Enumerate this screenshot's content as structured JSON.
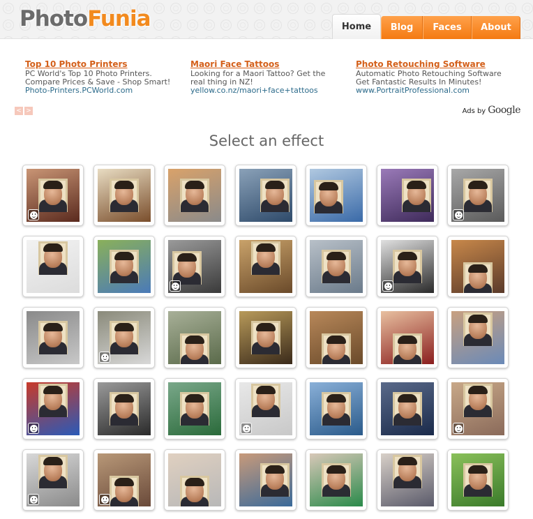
{
  "site": {
    "logo_part1": "Photo",
    "logo_part2": "Funia"
  },
  "nav": {
    "tabs": [
      "Home",
      "Blog",
      "Faces",
      "About"
    ],
    "active": "Home"
  },
  "ads": [
    {
      "title": "Top 10 Photo Printers",
      "line1": "PC World's Top 10 Photo Printers.",
      "line2": "Compare Prices & Save - Shop Smart!",
      "url": "Photo-Printers.PCWorld.com"
    },
    {
      "title": "Maori Face Tattoos",
      "line1": "Looking for a Maori Tattoo? Get the",
      "line2": "real thing in NZ!",
      "url": "yellow.co.nz/maori+face+tattoos"
    },
    {
      "title": "Photo Retouching Software",
      "line1": "Automatic Photo Retouching Software",
      "line2": "Get Fantastic Results In Minutes!",
      "url": "www.PortraitProfessional.com"
    }
  ],
  "ads_nav": {
    "prev": "<",
    "next": ">"
  },
  "ads_by": {
    "label": "Ads by",
    "brand": "Google"
  },
  "heading": "Select an effect",
  "colors": {
    "accent": "#f47a12",
    "ad_title": "#d4601a",
    "ad_url": "#2b6a8a"
  },
  "effects_icon": "smiley-face-icon",
  "effects": [
    [
      {
        "name": "carnival-dancer",
        "bg": "#5a2a1e",
        "bg2": "#c99575",
        "face": "center",
        "smiley": true
      },
      {
        "name": "old-book-page",
        "bg": "#7a4e2c",
        "bg2": "#e8dcc2",
        "face": "center",
        "smiley": false
      },
      {
        "name": "mall-poster",
        "bg": "#8a8a8a",
        "bg2": "#d9a26a",
        "face": "center",
        "smiley": false
      },
      {
        "name": "city-billboard",
        "bg": "#2e4a6a",
        "bg2": "#8aa1b8",
        "face": "right",
        "smiley": false
      },
      {
        "name": "skyscraper-billboard",
        "bg": "#3a6aa8",
        "bg2": "#b0c8e0",
        "face": "left",
        "smiley": false
      },
      {
        "name": "purple-sky-screen",
        "bg": "#3e2a5a",
        "bg2": "#9a7ab8",
        "face": "right",
        "smiley": false
      },
      {
        "name": "pirate-captain",
        "bg": "#5a5a5a",
        "bg2": "#a8a8a8",
        "face": "center",
        "smiley": true
      }
    ],
    [
      {
        "name": "pop-art-gallery",
        "bg": "#dcdcdc",
        "bg2": "#f2f2f2",
        "face": "top",
        "smiley": false
      },
      {
        "name": "park-poster",
        "bg": "#4a7ab8",
        "bg2": "#8ab05a",
        "face": "center",
        "smiley": false
      },
      {
        "name": "hooded-portrait",
        "bg": "#3a3a3a",
        "bg2": "#9a9a9a",
        "face": "left",
        "smiley": true
      },
      {
        "name": "palace-facade",
        "bg": "#6a4a2a",
        "bg2": "#c9a26a",
        "face": "top",
        "smiley": false
      },
      {
        "name": "city-mosaic",
        "bg": "#6a7a8a",
        "bg2": "#b8c0c8",
        "face": "center",
        "smiley": false
      },
      {
        "name": "bride-portrait",
        "bg": "#2a2a2a",
        "bg2": "#e0e0e0",
        "face": "center",
        "smiley": true
      },
      {
        "name": "pin-up-picture",
        "bg": "#5a3a2a",
        "bg2": "#c8884a",
        "face": "bottom",
        "smiley": false
      }
    ],
    [
      {
        "name": "car-door",
        "bg": "#c8c8c8",
        "bg2": "#8a8a8a",
        "face": "center",
        "smiley": false
      },
      {
        "name": "old-woman-photo",
        "bg": "#d8d8d8",
        "bg2": "#8a8a7a",
        "face": "center",
        "smiley": true
      },
      {
        "name": "stone-wall-poster",
        "bg": "#5a6a4a",
        "bg2": "#a8b098",
        "face": "bottom",
        "smiley": false
      },
      {
        "name": "mosaic-frame",
        "bg": "#3a2a1a",
        "bg2": "#b89a5a",
        "face": "center",
        "smiley": false
      },
      {
        "name": "hands-holding-photos",
        "bg": "#6a4a2a",
        "bg2": "#b8885a",
        "face": "bottom",
        "smiley": false
      },
      {
        "name": "calendar-girl",
        "bg": "#8a1e1e",
        "bg2": "#e8c0a0",
        "face": "bottom",
        "smiley": false
      },
      {
        "name": "cat-and-screen",
        "bg": "#6a8ab8",
        "bg2": "#c8a080",
        "face": "top",
        "smiley": false
      }
    ],
    [
      {
        "name": "superhero",
        "bg": "#2a5ab8",
        "bg2": "#c83a2a",
        "face": "top",
        "smiley": true
      },
      {
        "name": "ornate-mirror",
        "bg": "#2a2a2a",
        "bg2": "#9a9a9a",
        "face": "center",
        "smiley": false
      },
      {
        "name": "green-wall-painting",
        "bg": "#2a6a3a",
        "bg2": "#7aa88a",
        "face": "center",
        "smiley": false
      },
      {
        "name": "holding-sign",
        "bg": "#c8c8c8",
        "bg2": "#e8e8e8",
        "face": "top",
        "smiley": true
      },
      {
        "name": "building-mural",
        "bg": "#2a5a8a",
        "bg2": "#8ab0d8",
        "face": "center",
        "smiley": false
      },
      {
        "name": "night-building",
        "bg": "#1a2a4a",
        "bg2": "#5a6a8a",
        "face": "center",
        "smiley": false
      },
      {
        "name": "tattoo-chest",
        "bg": "#8a6a5a",
        "bg2": "#c8a888",
        "face": "top",
        "smiley": true
      }
    ],
    [
      {
        "name": "vintage-pilot",
        "bg": "#8a8a8a",
        "bg2": "#d8d8d8",
        "face": "top",
        "smiley": true
      },
      {
        "name": "pastel-drawing",
        "bg": "#6a4a3a",
        "bg2": "#b89878",
        "face": "bottom",
        "smiley": true
      },
      {
        "name": "model-holding-photo",
        "bg": "#b8b8b8",
        "bg2": "#e0d0c0",
        "face": "bottom",
        "smiley": false
      },
      {
        "name": "face-painting",
        "bg": "#3a6a9a",
        "bg2": "#c89a7a",
        "face": "right",
        "smiley": false
      },
      {
        "name": "printed-dress",
        "bg": "#2a8a4a",
        "bg2": "#d8c8b8",
        "face": "center",
        "smiley": false
      },
      {
        "name": "street-poster",
        "bg": "#5a5a6a",
        "bg2": "#d8d0c8",
        "face": "top",
        "smiley": false
      },
      {
        "name": "grass-tshirt",
        "bg": "#3a7a2a",
        "bg2": "#8ac05a",
        "face": "center",
        "smiley": false
      }
    ]
  ]
}
